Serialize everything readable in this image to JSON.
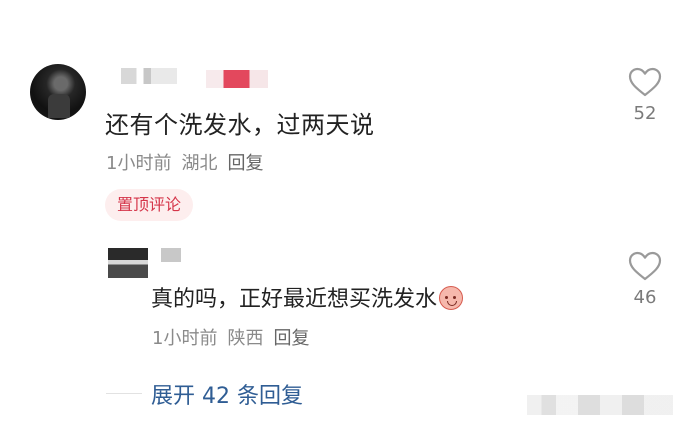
{
  "comment": {
    "text": "还有个洗发水，过两天说",
    "time": "1小时前",
    "location": "湖北",
    "reply_label": "回复",
    "pinned_label": "置顶评论",
    "likes": "52"
  },
  "reply": {
    "text": "真的吗，正好最近想买洗发水",
    "emoji": "emoji-sticker",
    "time": "1小时前",
    "location": "陕西",
    "reply_label": "回复",
    "likes": "46"
  },
  "expand": {
    "label": "展开 42 条回复"
  },
  "icons": {
    "like": "heart-outline-icon"
  },
  "colors": {
    "pinned_text": "#d5354a",
    "pinned_bg": "#fdeeee",
    "link": "#2f5d94",
    "meta": "#8a8a8a"
  }
}
